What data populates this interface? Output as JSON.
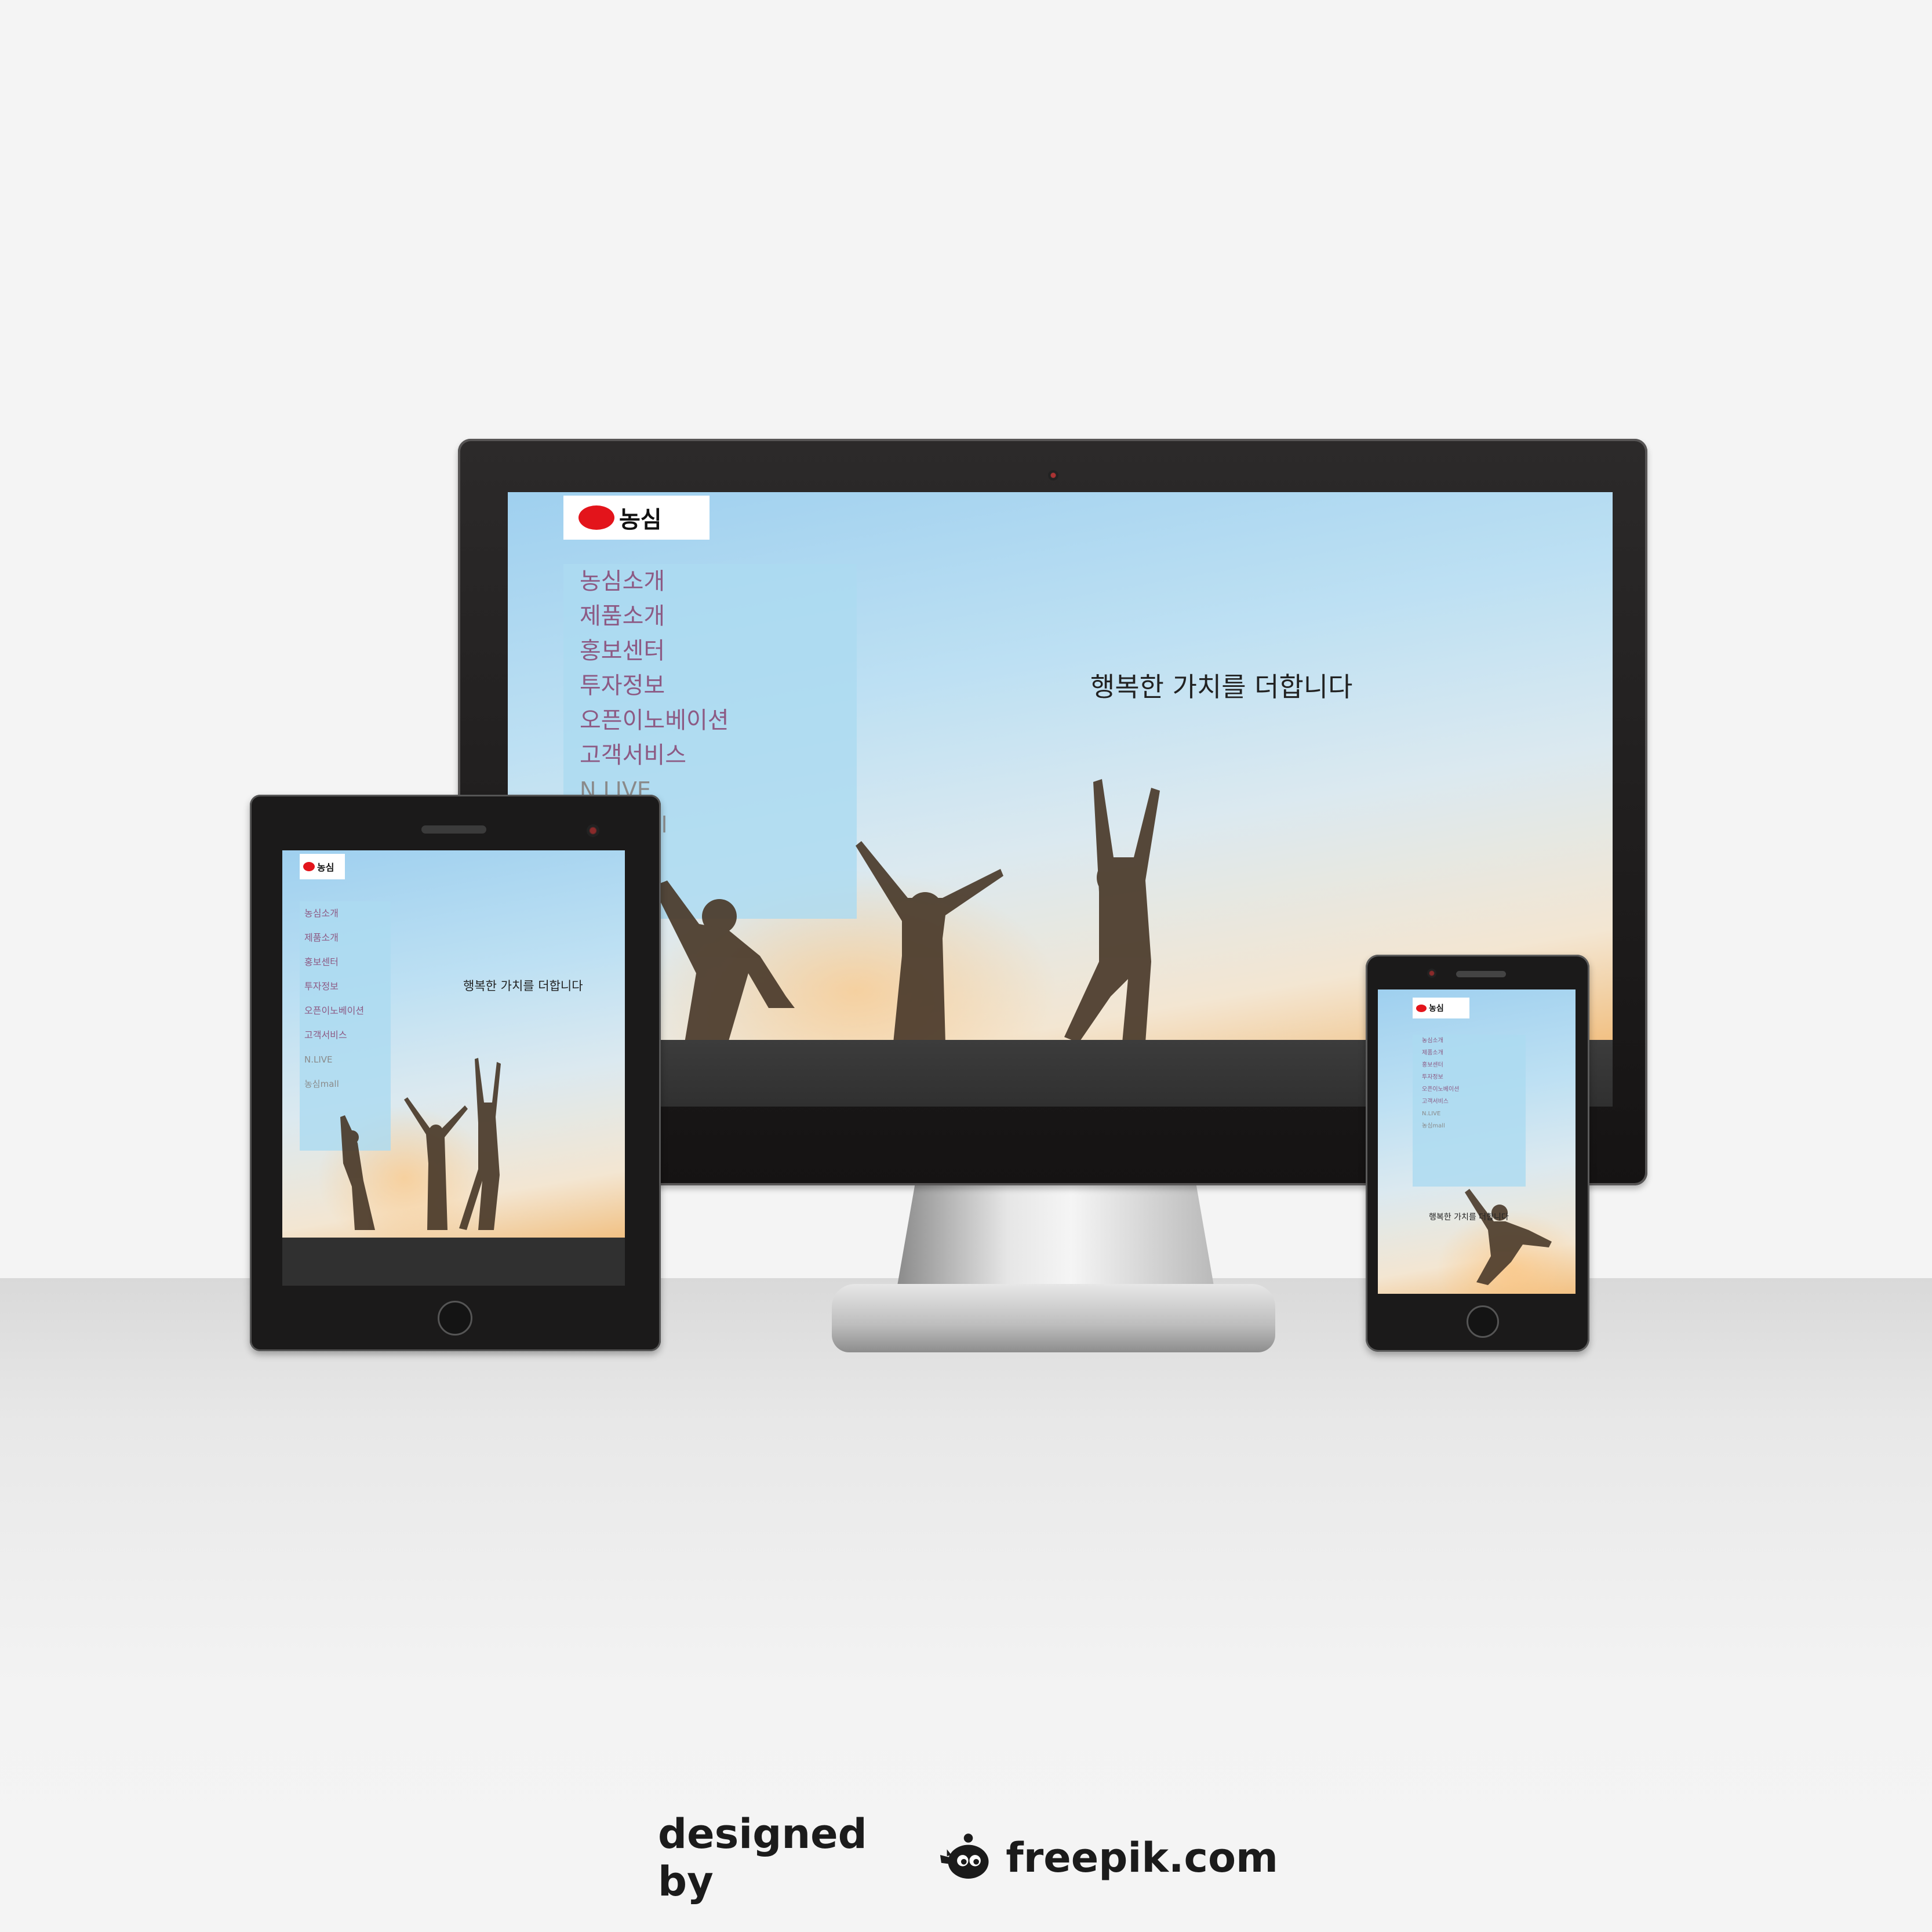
{
  "site": {
    "logo_text": "농심",
    "headline": "행복한 가치를 더합니다",
    "menu": [
      "농심소개",
      "제품소개",
      "홍보센터",
      "투자정보",
      "오픈이노베이션",
      "고객서비스",
      "N.LIVE",
      "농심mall"
    ]
  },
  "watermark": {
    "prefix": "designed by",
    "brand": "freepik.com"
  },
  "colors": {
    "menu_text": "#8d5a84",
    "menu_panel": "#acdbf0",
    "logo_red": "#e3141b",
    "sky": "#bde0f3"
  },
  "icons": [
    "freepik-mascot-icon",
    "home-button-icon",
    "camera-icon"
  ]
}
